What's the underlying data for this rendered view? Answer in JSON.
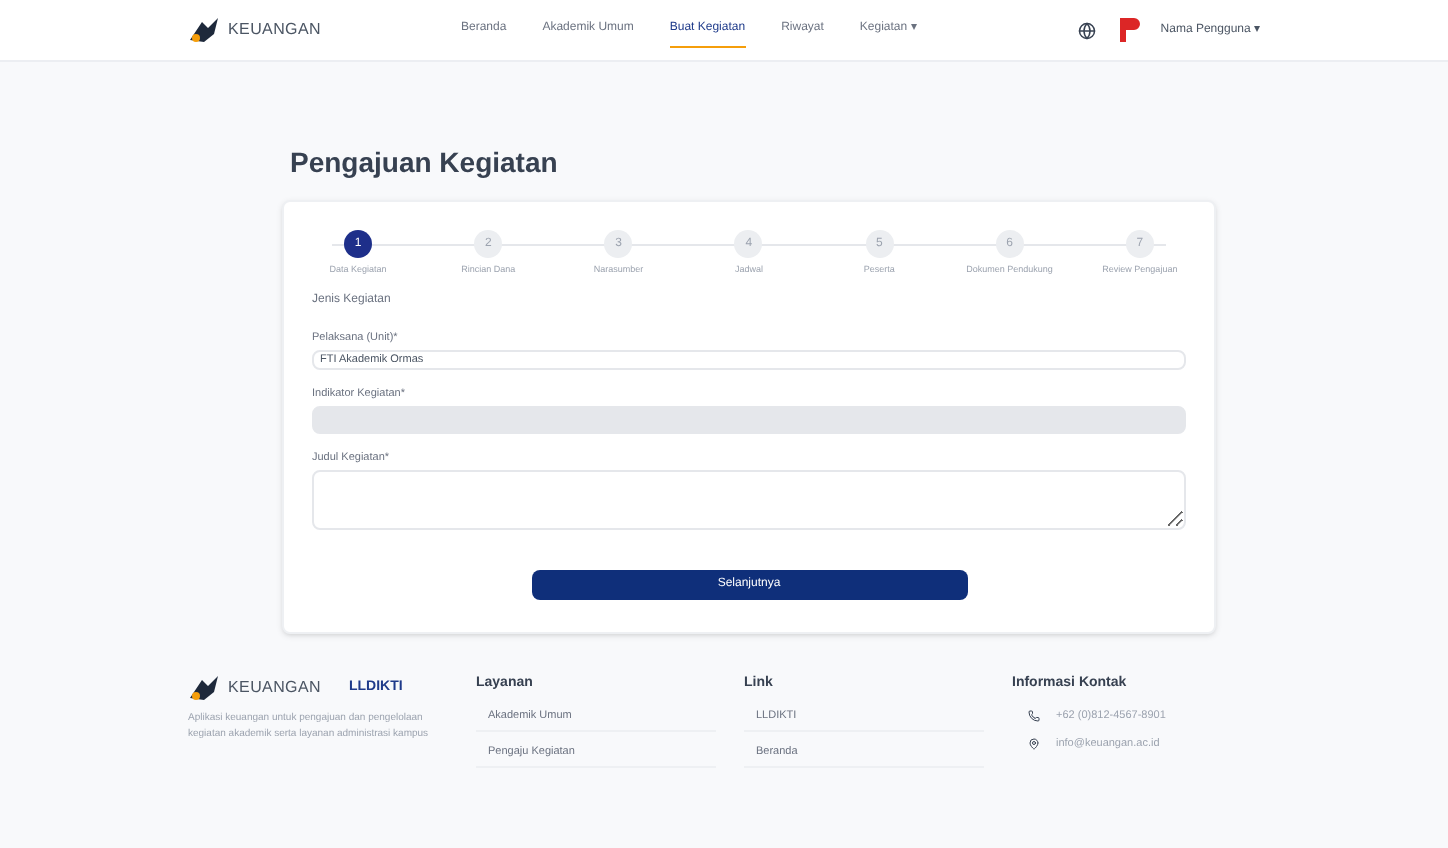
{
  "header": {
    "logo": "KEUANGAN",
    "nav": [
      {
        "label": "Beranda",
        "selected": false
      },
      {
        "label": "Akademik Umum",
        "selected": false
      },
      {
        "label": "Buat Kegiatan",
        "selected": true
      },
      {
        "label": "Riwayat",
        "selected": false
      },
      {
        "label": "Kegiatan ▾",
        "selected": false
      }
    ],
    "user": "Nama Pengguna ▾"
  },
  "page_title": "Pengajuan Kegiatan",
  "steps": [
    {
      "number": "1",
      "label": "Data Kegiatan",
      "selected": true
    },
    {
      "number": "2",
      "label": "Rincian Dana",
      "selected": false
    },
    {
      "number": "3",
      "label": "Narasumber",
      "selected": false
    },
    {
      "number": "4",
      "label": "Jadwal",
      "selected": false
    },
    {
      "number": "5",
      "label": "Peserta",
      "selected": false
    },
    {
      "number": "6",
      "label": "Dokumen Pendukung",
      "selected": false
    },
    {
      "number": "7",
      "label": "Review Pengajuan",
      "selected": false
    }
  ],
  "section_label": "Jenis Kegiatan",
  "fields": [
    {
      "kind": "input",
      "label": "Pelaksana (Unit)*",
      "value": "FTI Akademik Ormas",
      "disabled": false
    },
    {
      "kind": "input",
      "label": "Indikator Kegiatan*",
      "disabled": true
    },
    {
      "kind": "textarea",
      "label": "Judul Kegiatan*",
      "disabled": false
    }
  ],
  "next_button": "Selanjutnya",
  "footer": {
    "logo": "KEUANGAN",
    "partner": "LLDIKTI",
    "about": "Aplikasi keuangan untuk pengajuan dan pengelolaan kegiatan akademik serta layanan administrasi kampus",
    "columns": [
      {
        "title": "Layanan",
        "items": [
          "Akademik Umum",
          "Pengaju Kegiatan"
        ]
      },
      {
        "title": "Link",
        "items": [
          "LLDIKTI",
          "Beranda"
        ]
      }
    ],
    "contact_title": "Informasi Kontak",
    "contacts": [
      {
        "kind": "phone",
        "text": "+62 (0)812-4567-8901"
      },
      {
        "kind": "mail",
        "text": "info@keuangan.ac.id"
      }
    ]
  }
}
